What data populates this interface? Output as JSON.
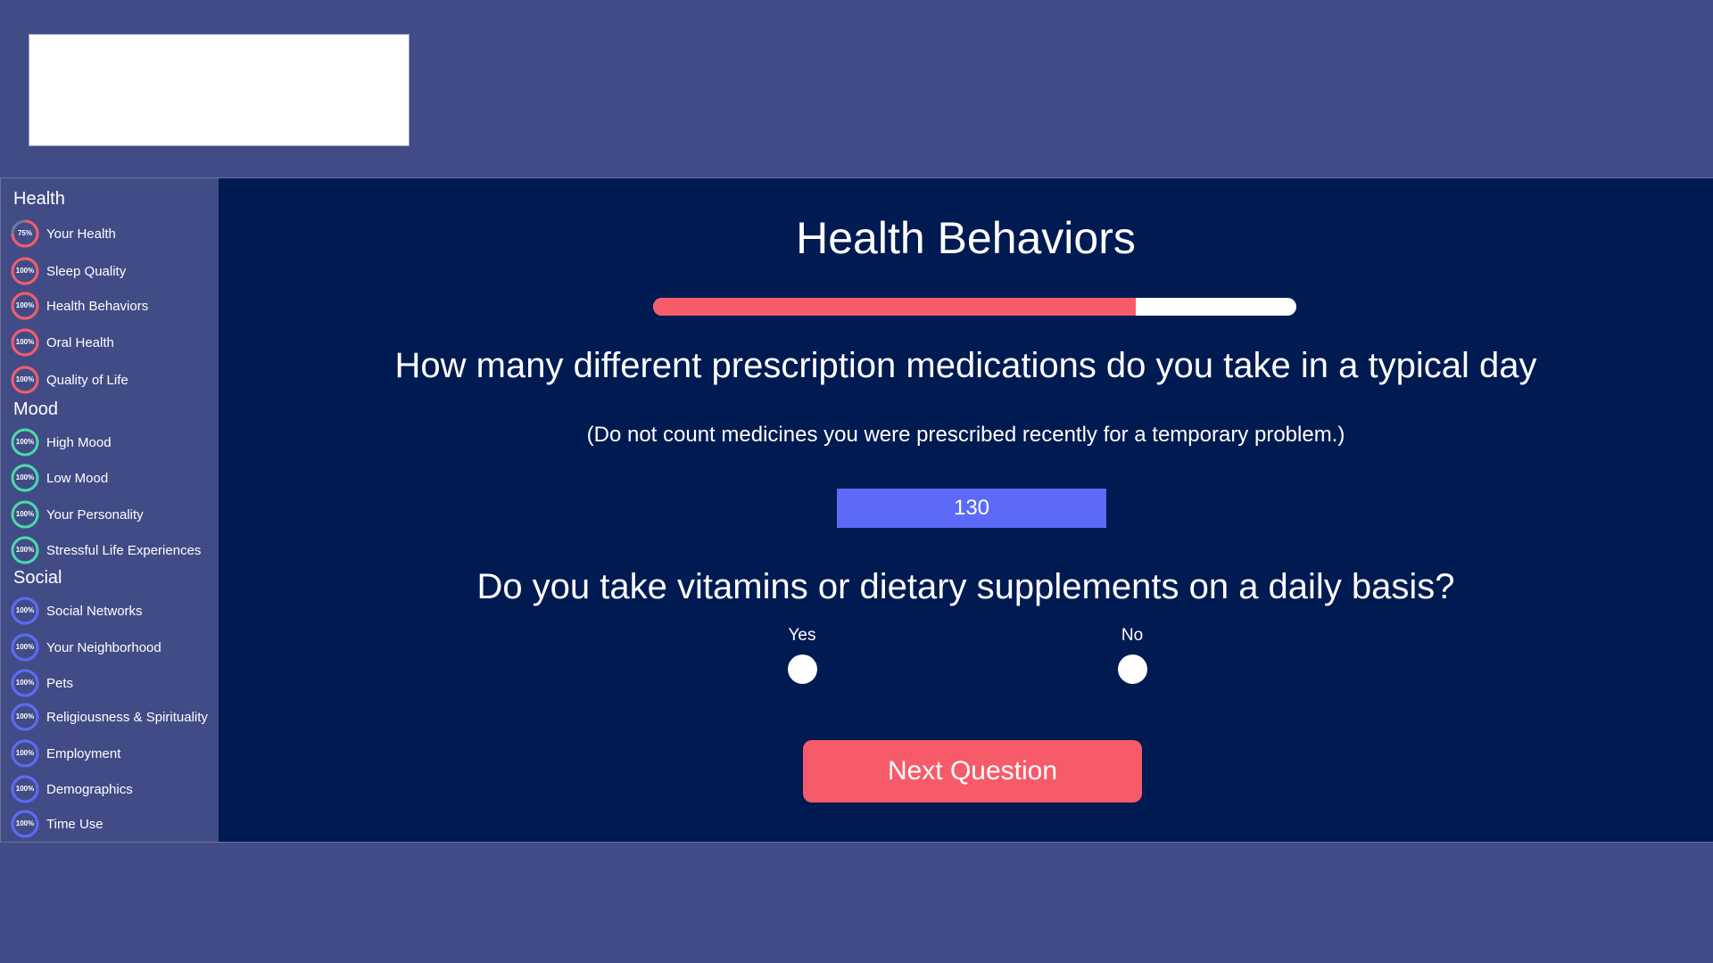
{
  "colors": {
    "health": "#f75b6a",
    "mood": "#4ad9a8",
    "social": "#5c6af7",
    "main_bg": "#001a52",
    "frame_bg": "#414c86"
  },
  "sidebar": {
    "sections": [
      {
        "title": "Health",
        "color": "#f75b6a",
        "items": [
          {
            "label": "Your Health",
            "percent_text": "75%",
            "progress": 0.75
          },
          {
            "label": "Sleep Quality",
            "percent_text": "100%",
            "progress": 1
          },
          {
            "label": "Health Behaviors",
            "percent_text": "100%",
            "progress": 1
          },
          {
            "label": "Oral Health",
            "percent_text": "100%",
            "progress": 1
          },
          {
            "label": "Quality of Life",
            "percent_text": "100%",
            "progress": 1
          }
        ]
      },
      {
        "title": "Mood",
        "color": "#4ad9a8",
        "items": [
          {
            "label": "High Mood",
            "percent_text": "100%",
            "progress": 1
          },
          {
            "label": "Low Mood",
            "percent_text": "100%",
            "progress": 1
          },
          {
            "label": "Your Personality",
            "percent_text": "100%",
            "progress": 1
          },
          {
            "label": "Stressful Life Experiences",
            "percent_text": "100%",
            "progress": 1
          }
        ]
      },
      {
        "title": "Social",
        "color": "#5c6af7",
        "items": [
          {
            "label": "Social Networks",
            "percent_text": "100%",
            "progress": 1
          },
          {
            "label": "Your Neighborhood",
            "percent_text": "100%",
            "progress": 1
          },
          {
            "label": "Pets",
            "percent_text": "100%",
            "progress": 1
          },
          {
            "label": "Religiousness & Spirituality",
            "percent_text": "100%",
            "progress": 1
          },
          {
            "label": "Employment",
            "percent_text": "100%",
            "progress": 1
          },
          {
            "label": "Demographics",
            "percent_text": "100%",
            "progress": 1
          },
          {
            "label": "Time Use",
            "percent_text": "100%",
            "progress": 1
          }
        ]
      }
    ]
  },
  "main": {
    "title": "Health Behaviors",
    "progress": 0.75,
    "question1": "How many different prescription medications do you take in a typical day",
    "question1_note": "(Do not count medicines you were prescribed recently for a temporary problem.)",
    "med_input_value": "130",
    "question2": "Do you take vitamins or dietary supplements on a daily basis?",
    "options": [
      "Yes",
      "No"
    ],
    "next_label": "Next Question"
  }
}
